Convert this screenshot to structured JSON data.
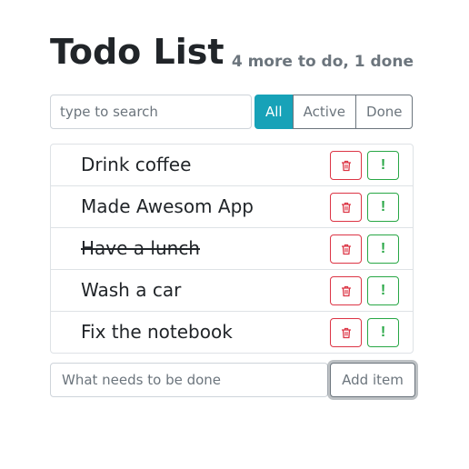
{
  "header": {
    "title": "Todo List",
    "status": "4 more to do, 1 done"
  },
  "search": {
    "placeholder": "type to search",
    "value": ""
  },
  "filters": [
    {
      "label": "All",
      "active": true
    },
    {
      "label": "Active",
      "active": false
    },
    {
      "label": "Done",
      "active": false
    }
  ],
  "todos": [
    {
      "label": "Drink coffee",
      "done": false
    },
    {
      "label": "Made Awesom App",
      "done": false
    },
    {
      "label": "Have a lunch",
      "done": true
    },
    {
      "label": "Wash a car",
      "done": false
    },
    {
      "label": "Fix the notebook",
      "done": false
    }
  ],
  "item_actions": {
    "delete_icon": "trash-icon",
    "important_icon": "exclamation-icon",
    "important_glyph": "!"
  },
  "add": {
    "placeholder": "What needs to be done",
    "value": "",
    "button_label": "Add item"
  },
  "colors": {
    "primary": "#17a2b8",
    "danger": "#dc3545",
    "success": "#28a745",
    "secondary": "#6c757d"
  }
}
